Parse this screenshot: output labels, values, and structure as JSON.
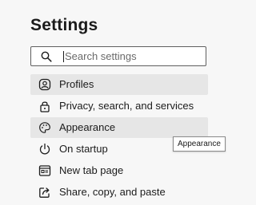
{
  "page": {
    "title": "Settings"
  },
  "search": {
    "placeholder": "Search settings"
  },
  "nav": {
    "items": [
      {
        "label": "Profiles",
        "icon": "profile-icon",
        "state": "selected"
      },
      {
        "label": "Privacy, search, and services",
        "icon": "lock-icon",
        "state": "normal"
      },
      {
        "label": "Appearance",
        "icon": "appearance-icon",
        "state": "hovered"
      },
      {
        "label": "On startup",
        "icon": "power-icon",
        "state": "normal"
      },
      {
        "label": "New tab page",
        "icon": "new-tab-icon",
        "state": "normal"
      },
      {
        "label": "Share, copy, and paste",
        "icon": "share-icon",
        "state": "normal"
      }
    ]
  },
  "tooltip": {
    "text": "Appearance"
  },
  "colors": {
    "accent": "#0f6cbd",
    "background": "#f7f7f7",
    "selected_bg": "#e6e6e6"
  }
}
